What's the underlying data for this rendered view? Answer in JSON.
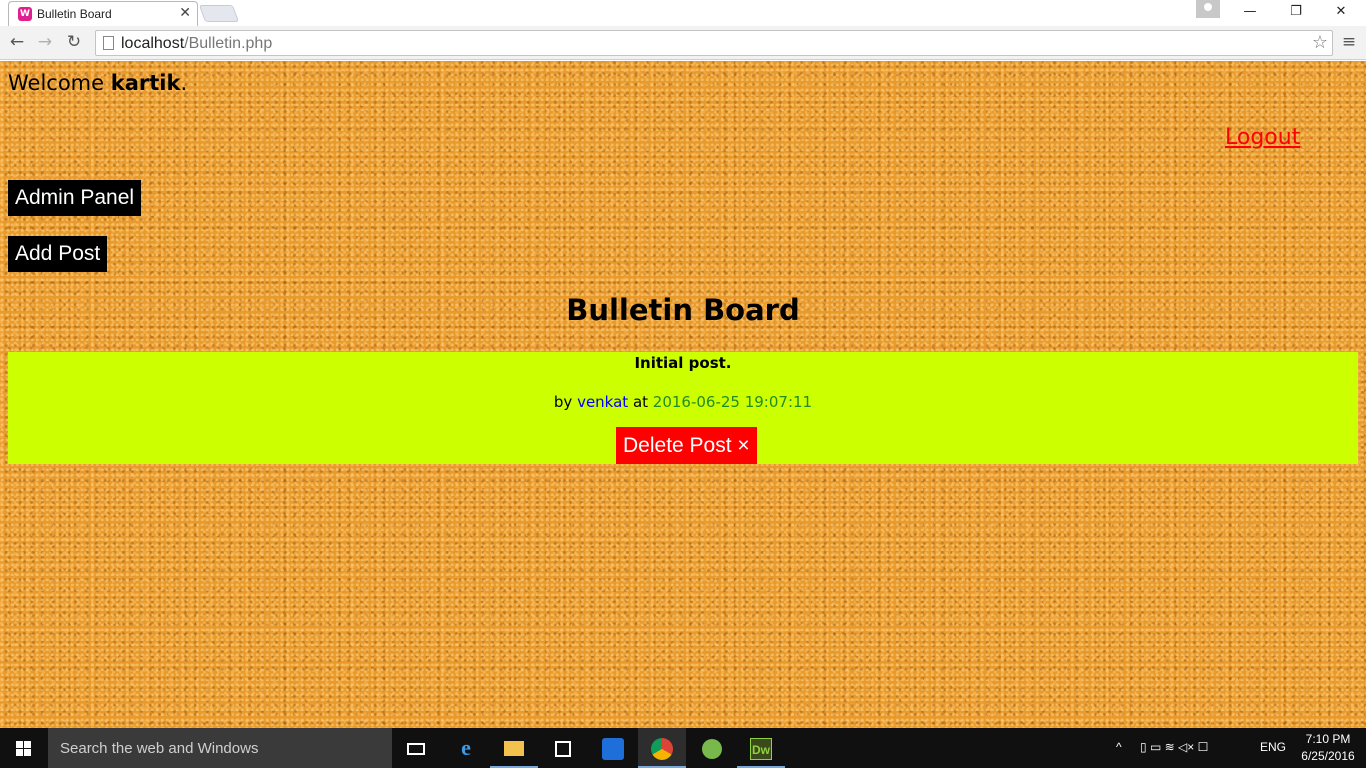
{
  "browser": {
    "tab": {
      "title": "Bulletin Board",
      "favicon": "W",
      "close": "✕"
    },
    "window_controls": {
      "minimize": "—",
      "maximize": "❐",
      "close": "✕"
    },
    "url": {
      "host": "localhost",
      "path": "/Bulletin.php"
    }
  },
  "page": {
    "welcome_prefix": "Welcome ",
    "username": "kartik",
    "welcome_suffix": ".",
    "logout": "Logout",
    "admin_panel": "Admin Panel",
    "add_post": "Add Post",
    "title": "Bulletin Board",
    "posts": [
      {
        "title": "Initial post.",
        "by_label": "by ",
        "author": "venkat",
        "at_label": " at ",
        "date": "2016-06-25 19:07:11",
        "delete_label": "Delete Post ×"
      }
    ],
    "colors": {
      "post_background": "#ccff00",
      "logout": "#ff0000",
      "delete_button": "#ff0000",
      "author": "#0000ff",
      "date": "#228b22"
    }
  },
  "taskbar": {
    "search_placeholder": "Search the web and Windows",
    "apps": [
      "task-view",
      "edge",
      "file-explorer",
      "store",
      "dropbox",
      "chrome",
      "android-studio",
      "dreamweaver"
    ],
    "dreamweaver_label": "Dw",
    "language": "ENG",
    "time": "7:10 PM",
    "date": "6/25/2016"
  }
}
